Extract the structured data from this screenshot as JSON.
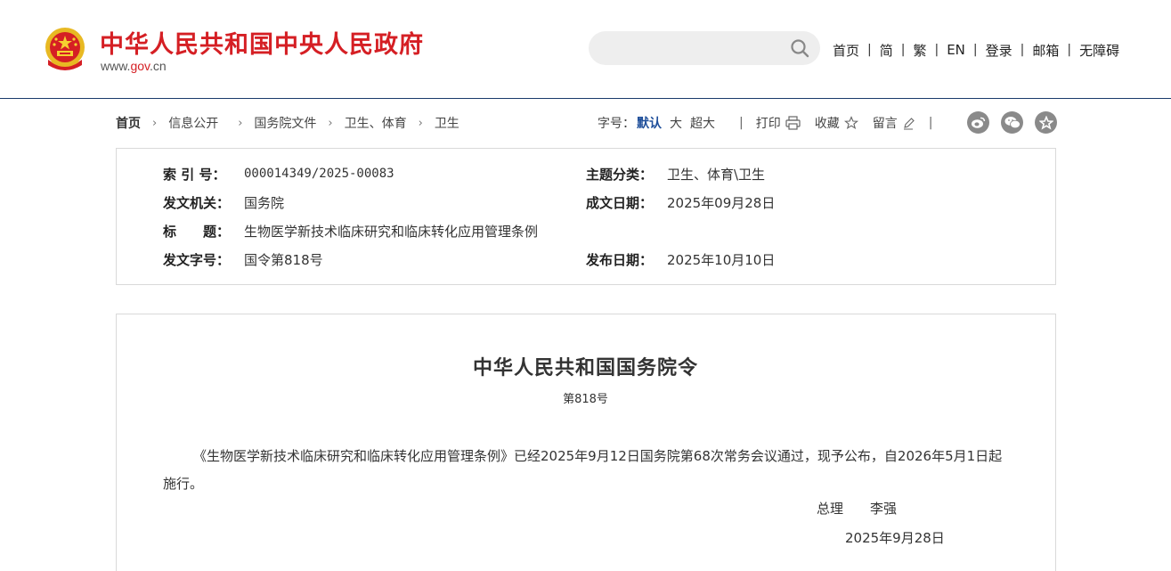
{
  "header": {
    "site_title": "中华人民共和国中央人民政府",
    "site_url_prefix": "www.",
    "site_url_brand": "gov",
    "site_url_suffix": ".cn",
    "search": {
      "placeholder": "",
      "value": ""
    },
    "nav": [
      "首页",
      "简",
      "繁",
      "EN",
      "登录",
      "邮箱",
      "无障碍"
    ],
    "nav_separator": "|",
    "brand_color": "#d51f24",
    "border_color": "#1a3a6b"
  },
  "breadcrumb": [
    "首页",
    "信息公开",
    "国务院文件",
    "卫生、体育",
    "卫生"
  ],
  "tools": {
    "font_size_label": "字号：",
    "font_sizes": [
      "默认",
      "大",
      "超大"
    ],
    "separator": "|",
    "print_label": "打印",
    "favorite_label": "收藏",
    "comment_label": "留言",
    "share_icons": [
      "weibo-icon",
      "wechat-icon",
      "star-icon"
    ]
  },
  "meta": {
    "index_label": "索 引 号：",
    "index_value": "000014349/2025-00083",
    "topic_label": "主题分类：",
    "topic_value": "卫生、体育\\卫生",
    "issuer_label": "发文机关：",
    "issuer_value": "国务院",
    "written_date_label": "成文日期：",
    "written_date_value": "2025年09月28日",
    "title_label": "标　　题：",
    "title_value": "生物医学新技术临床研究和临床转化应用管理条例",
    "doc_number_label": "发文字号：",
    "doc_number_value": "国令第818号",
    "publish_date_label": "发布日期：",
    "publish_date_value": "2025年10月10日"
  },
  "document": {
    "title": "中华人民共和国国务院令",
    "number": "第818号",
    "body": "《生物医学新技术临床研究和临床转化应用管理条例》已经2025年9月12日国务院第68次常务会议通过，现予公布，自2026年5月1日起施行。",
    "signer_title": "总理",
    "signer_name": "李强",
    "sign_date": "2025年9月28日"
  }
}
